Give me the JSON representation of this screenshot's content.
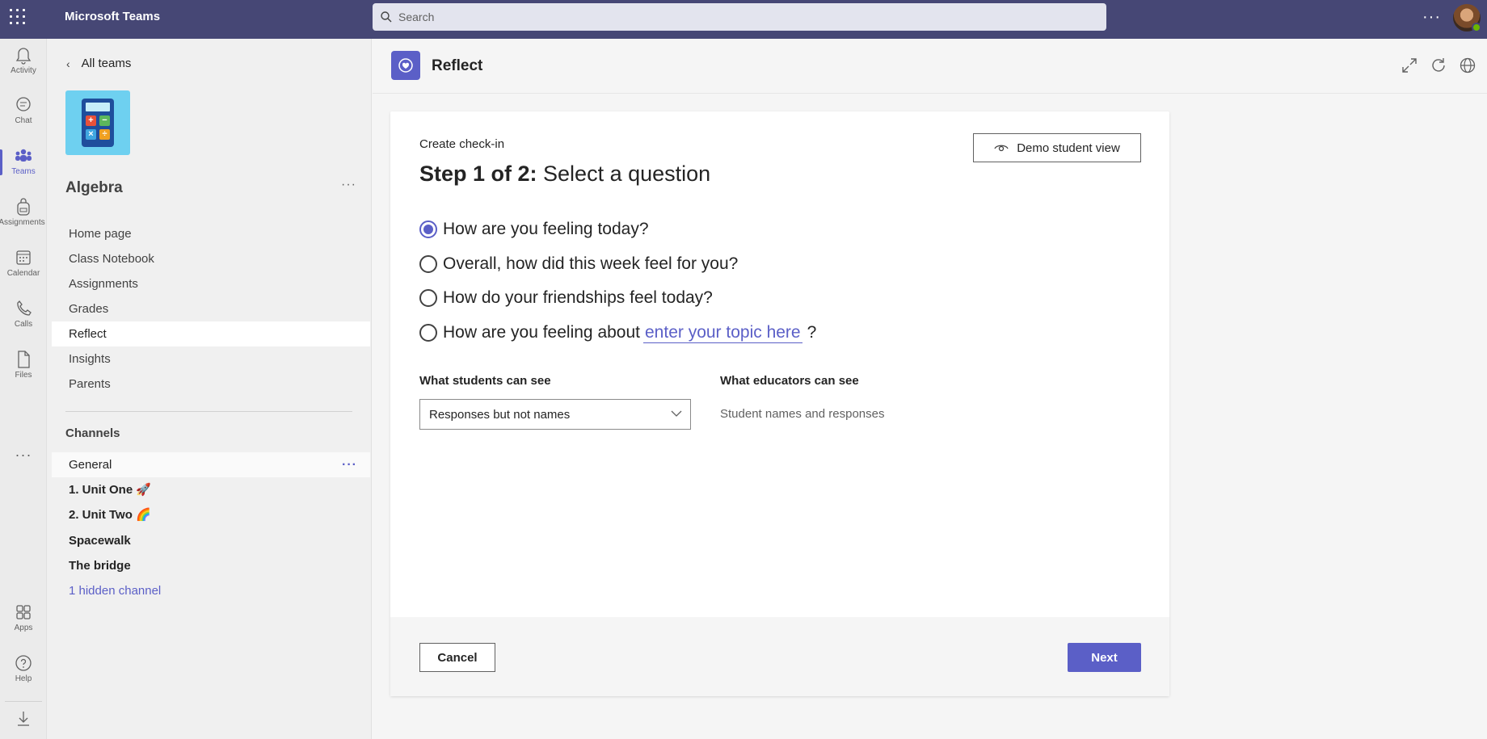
{
  "topbar": {
    "app_title": "Microsoft Teams",
    "search_placeholder": "Search",
    "more": "···"
  },
  "rail": {
    "items": [
      {
        "label": "Activity",
        "icon": "bell-icon"
      },
      {
        "label": "Chat",
        "icon": "chat-icon"
      },
      {
        "label": "Teams",
        "icon": "teams-icon",
        "active": true
      },
      {
        "label": "Assignments",
        "icon": "backpack-icon"
      },
      {
        "label": "Calendar",
        "icon": "calendar-icon"
      },
      {
        "label": "Calls",
        "icon": "phone-icon"
      },
      {
        "label": "Files",
        "icon": "file-icon"
      },
      {
        "label": "Apps",
        "icon": "apps-icon"
      },
      {
        "label": "Help",
        "icon": "help-icon"
      }
    ],
    "more": "···",
    "download_icon": "download-icon"
  },
  "sidebar": {
    "back_label": "All teams",
    "team_name": "Algebra",
    "team_more": "···",
    "nav": [
      "Home page",
      "Class Notebook",
      "Assignments",
      "Grades",
      "Reflect",
      "Insights",
      "Parents"
    ],
    "active_nav": "Reflect",
    "channels_heading": "Channels",
    "channels": [
      {
        "label": "General",
        "bold": false
      },
      {
        "label": "1. Unit One 🚀",
        "bold": true
      },
      {
        "label": "2. Unit Two 🌈",
        "bold": true
      },
      {
        "label": "Spacewalk",
        "bold": true
      },
      {
        "label": "The bridge",
        "bold": true
      }
    ],
    "hidden_channels": "1 hidden channel",
    "channel_more": "···"
  },
  "app": {
    "name": "Reflect",
    "header_icons": [
      "expand-icon",
      "refresh-icon",
      "globe-icon"
    ]
  },
  "form": {
    "subtitle": "Create check-in",
    "step_prefix": "Step 1 of 2:",
    "step_title": " Select a question",
    "demo_button": "Demo student view",
    "questions": [
      {
        "text": "How are you feeling today?",
        "checked": true
      },
      {
        "text": "Overall, how did this week feel for you?",
        "checked": false
      },
      {
        "text": "How do your friendships feel today?",
        "checked": false
      },
      {
        "text": "How are you feeling about",
        "checked": false,
        "topic_placeholder": "enter your topic here",
        "suffix": "?"
      }
    ],
    "students_label": "What students can see",
    "students_value": "Responses but not names",
    "educators_label": "What educators can see",
    "educators_value": "Student names and responses",
    "cancel": "Cancel",
    "next": "Next"
  },
  "colors": {
    "brand": "#464775",
    "accent": "#5b5fc7",
    "presence": "#6bb700"
  }
}
